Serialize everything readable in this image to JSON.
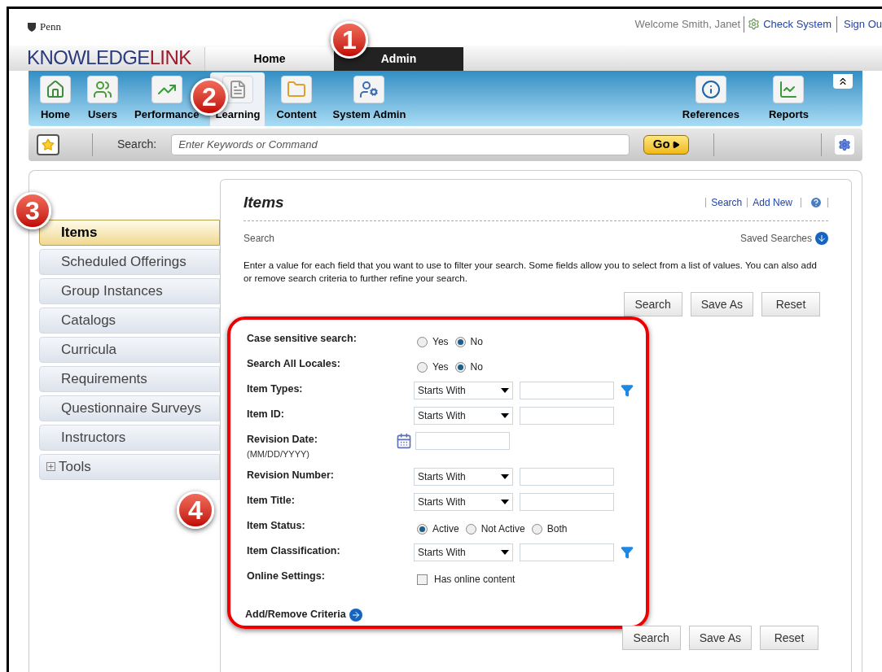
{
  "header": {
    "institution": "Penn",
    "logo": {
      "first": "KNOWLEDGE",
      "second": "LINK"
    },
    "welcome": "Welcome Smith, Janet",
    "links": [
      "Check System",
      "Sign Ou"
    ]
  },
  "top_tabs": [
    {
      "label": "Home",
      "selected": false
    },
    {
      "label": "Admin",
      "selected": true
    }
  ],
  "toolbar": {
    "items": [
      {
        "label": "Home",
        "kind": "home",
        "selected": false
      },
      {
        "label": "Users",
        "kind": "users",
        "selected": false
      },
      {
        "label": "Performance",
        "kind": "performance",
        "selected": false
      },
      {
        "label": "Learning",
        "kind": "learning",
        "selected": true
      },
      {
        "label": "Content",
        "kind": "content",
        "selected": false
      },
      {
        "label": "System Admin",
        "kind": "admin",
        "selected": false
      }
    ],
    "right_items": [
      {
        "label": "References",
        "kind": "info",
        "selected": false
      },
      {
        "label": "Reports",
        "kind": "reports",
        "selected": false
      }
    ]
  },
  "search_bar": {
    "label": "Search:",
    "placeholder": "Enter Keywords or Command",
    "go": "Go"
  },
  "sidebar": {
    "items": [
      {
        "label": "Items",
        "selected": true,
        "kind": "link"
      },
      {
        "label": "Scheduled Offerings",
        "selected": false,
        "kind": "link"
      },
      {
        "label": "Group Instances",
        "selected": false,
        "kind": "link"
      },
      {
        "label": "Catalogs",
        "selected": false,
        "kind": "link"
      },
      {
        "label": "Curricula",
        "selected": false,
        "kind": "link"
      },
      {
        "label": "Requirements",
        "selected": false,
        "kind": "link"
      },
      {
        "label": "Questionnaire Surveys",
        "selected": false,
        "kind": "link"
      },
      {
        "label": "Instructors",
        "selected": false,
        "kind": "link"
      },
      {
        "label": "Tools",
        "selected": false,
        "kind": "group"
      }
    ]
  },
  "main": {
    "title": "Items",
    "links": [
      "Search",
      "Add New"
    ],
    "section": "Search",
    "saved_searches": "Saved Searches",
    "description": "Enter a value for each field that you want to use to filter your search. Some fields allow you to select from a list of values. You can also add or remove search criteria to further refine your search.",
    "buttons_top": [
      "Search",
      "Save As",
      "Reset"
    ],
    "form": [
      {
        "kind": "radio",
        "label": "Case sensitive search:",
        "options": [
          {
            "label": "Yes",
            "selected": false
          },
          {
            "label": "No",
            "selected": true
          }
        ]
      },
      {
        "kind": "radio",
        "label": "Search All Locales:",
        "options": [
          {
            "label": "Yes",
            "selected": false
          },
          {
            "label": "No",
            "selected": true
          }
        ]
      },
      {
        "kind": "match",
        "label": "Item Types:",
        "operator": "Starts With",
        "filter": true
      },
      {
        "kind": "match",
        "label": "Item ID:",
        "operator": "Starts With",
        "filter": false
      },
      {
        "kind": "date",
        "label": "Revision Date:",
        "hint": "(MM/DD/YYYY)"
      },
      {
        "kind": "match",
        "label": "Revision Number:",
        "operator": "Starts With",
        "filter": false
      },
      {
        "kind": "match",
        "label": "Item Title:",
        "operator": "Starts With",
        "filter": false
      },
      {
        "kind": "radio",
        "label": "Item Status:",
        "options": [
          {
            "label": "Active",
            "selected": true
          },
          {
            "label": "Not Active",
            "selected": false
          },
          {
            "label": "Both",
            "selected": false
          }
        ]
      },
      {
        "kind": "match",
        "label": "Item Classification:",
        "operator": "Starts With",
        "filter": true
      },
      {
        "kind": "checkbox",
        "label": "Online Settings:",
        "option": "Has online content",
        "checked": false
      }
    ],
    "add_remove": "Add/Remove Criteria",
    "buttons_bottom": [
      "Search",
      "Save As",
      "Reset"
    ]
  },
  "callouts": [
    "1",
    "2",
    "3",
    "4"
  ]
}
